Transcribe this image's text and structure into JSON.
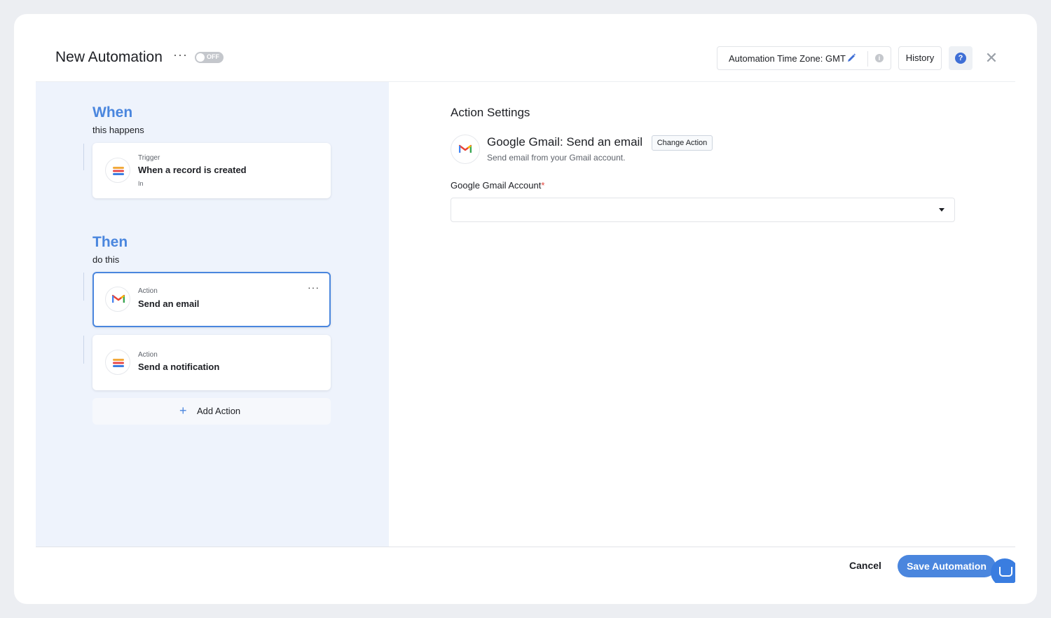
{
  "header": {
    "title": "New Automation",
    "more_label": "···",
    "toggle_label": "OFF",
    "timezone_label": "Automation Time Zone: GMT",
    "history_label": "History",
    "help_label": "?",
    "close_label": "✕"
  },
  "left": {
    "when_title": "When",
    "when_sub": "this happens",
    "trigger": {
      "label": "Trigger",
      "text": "When a record is created",
      "sub": "In"
    },
    "then_title": "Then",
    "then_sub": "do this",
    "actions": [
      {
        "label": "Action",
        "text": "Send an email",
        "icon": "gmail-icon",
        "selected": true,
        "more_label": "···"
      },
      {
        "label": "Action",
        "text": "Send a notification",
        "icon": "stack-icon",
        "selected": false
      }
    ],
    "add_action_label": "Add Action",
    "add_action_icon": "+"
  },
  "settings": {
    "title": "Action Settings",
    "app_name": "Google Gmail",
    "action_name": "Send an email",
    "change_label": "Change Action",
    "description": "Send email from your Gmail account.",
    "field_label": "Google Gmail Account",
    "required_marker": "*",
    "field_value": ""
  },
  "footer": {
    "cancel_label": "Cancel",
    "save_label": "Save Automation"
  },
  "colors": {
    "accent": "#4a86de",
    "panel_bg": "#eef3fc"
  }
}
